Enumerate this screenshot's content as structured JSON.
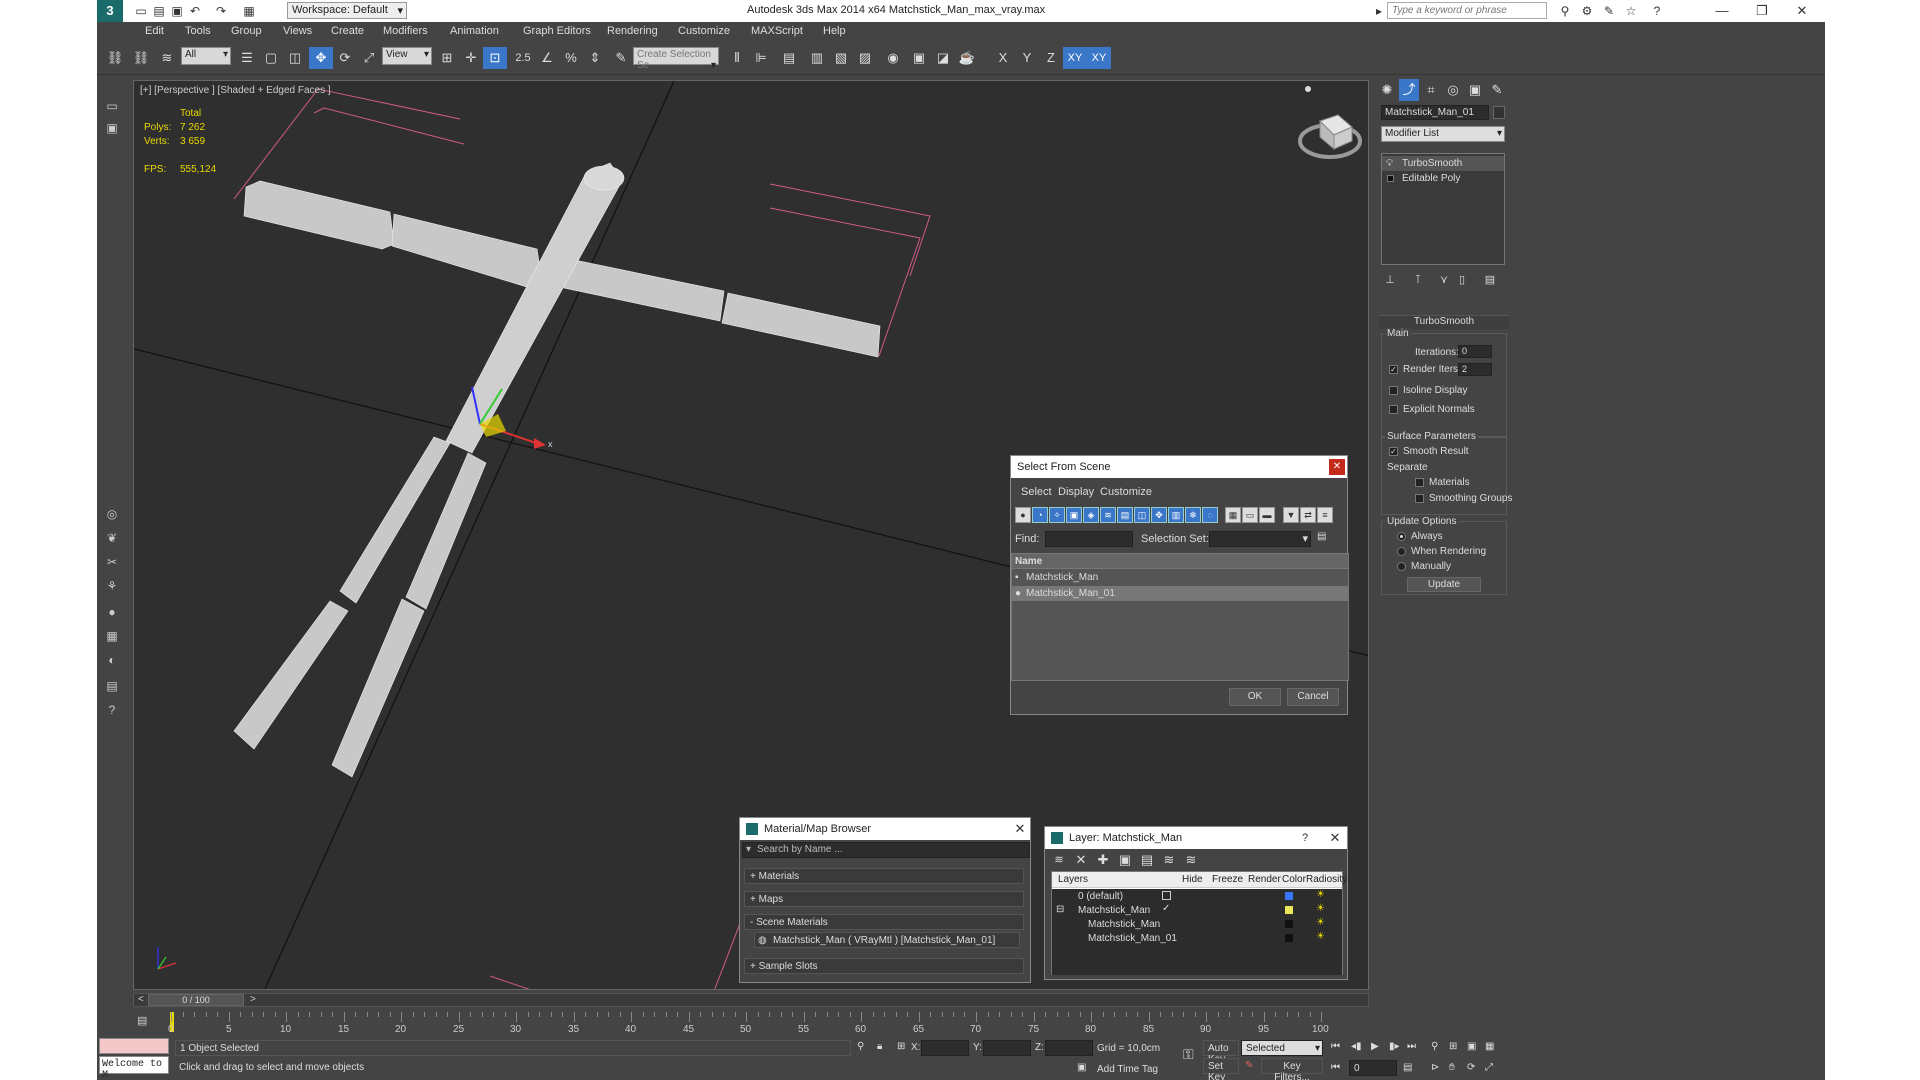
{
  "app": {
    "title": "Autodesk 3ds Max  2014 x64     Matchstick_Man_max_vray.max",
    "workspace": "Workspace: Default",
    "search_placeholder": "Type a keyword or phrase"
  },
  "menu": [
    "Edit",
    "Tools",
    "Group",
    "Views",
    "Create",
    "Modifiers",
    "Animation",
    "Graph Editors",
    "Rendering",
    "Customize",
    "MAXScript",
    "Help"
  ],
  "toolbar": {
    "filter": "All",
    "ref_coord": "View",
    "snap_label": "2.5",
    "selection_set_placeholder": "Create Selection Se"
  },
  "viewport": {
    "label": "[+] [Perspective ] [Shaded + Edged Faces ]",
    "stats_total": "Total",
    "polys_label": "Polys:",
    "polys_value": "7 262",
    "verts_label": "Verts:",
    "verts_value": "3 659",
    "fps_label": "FPS:",
    "fps_value": "555,124",
    "axis_x": "x",
    "axis_y": "y"
  },
  "command_panel": {
    "object_name": "Matchstick_Man_01",
    "modifier_list": "Modifier List",
    "stack": [
      "TurboSmooth",
      "Editable Poly"
    ],
    "rollout_title": "TurboSmooth",
    "main_label": "Main",
    "iterations_label": "Iterations:",
    "iterations_value": "0",
    "render_iters_label": "Render Iters:",
    "render_iters_value": "2",
    "isoline_display": "Isoline Display",
    "explicit_normals": "Explicit Normals",
    "surface_params": "Surface Parameters",
    "smooth_result": "Smooth Result",
    "separate_label": "Separate",
    "materials": "Materials",
    "smoothing_groups": "Smoothing Groups",
    "update_options": "Update Options",
    "always": "Always",
    "when_rendering": "When Rendering",
    "manually": "Manually",
    "update_button": "Update"
  },
  "select_dialog": {
    "title": "Select From Scene",
    "menu": [
      "Select",
      "Display",
      "Customize"
    ],
    "find_label": "Find:",
    "selection_set_label": "Selection Set:",
    "column_name": "Name",
    "items": [
      "Matchstick_Man",
      "Matchstick_Man_01"
    ],
    "ok": "OK",
    "cancel": "Cancel"
  },
  "material_browser": {
    "title": "Material/Map Browser",
    "search_placeholder": "Search by Name ...",
    "groups": [
      "+ Materials",
      "+ Maps",
      "- Scene Materials",
      "+ Sample Slots"
    ],
    "scene_material": "Matchstick_Man  ( VRayMtl ) [Matchstick_Man_01]"
  },
  "layer_dialog": {
    "title": "Layer: Matchstick_Man",
    "help": "?",
    "columns": [
      "Layers",
      "Hide",
      "Freeze",
      "Render",
      "Color",
      "Radiosity"
    ],
    "rows": [
      {
        "name": "0 (default)",
        "color": "#3a77ff"
      },
      {
        "name": "Matchstick_Man",
        "color": "#e8e85a"
      },
      {
        "name": "Matchstick_Man",
        "color": "#111111"
      },
      {
        "name": "Matchstick_Man_01",
        "color": "#111111"
      }
    ]
  },
  "timeline": {
    "frame": "0 / 100",
    "ticks": [
      "0",
      "5",
      "10",
      "15",
      "20",
      "25",
      "30",
      "35",
      "40",
      "45",
      "50",
      "55",
      "60",
      "65",
      "70",
      "75",
      "80",
      "85",
      "90",
      "95",
      "100"
    ]
  },
  "status": {
    "selected": "1 Object Selected",
    "prompt": "Click and drag to select and move objects",
    "welcome": "Welcome to M",
    "x_label": "X:",
    "y_label": "Y:",
    "z_label": "Z:",
    "grid": "Grid = 10,0cm",
    "add_time_tag": "Add Time Tag",
    "auto_key": "Auto Key",
    "set_key": "Set Key",
    "selected_dropdown": "Selected",
    "key_filters": "Key Filters...",
    "frame_value": "0"
  }
}
